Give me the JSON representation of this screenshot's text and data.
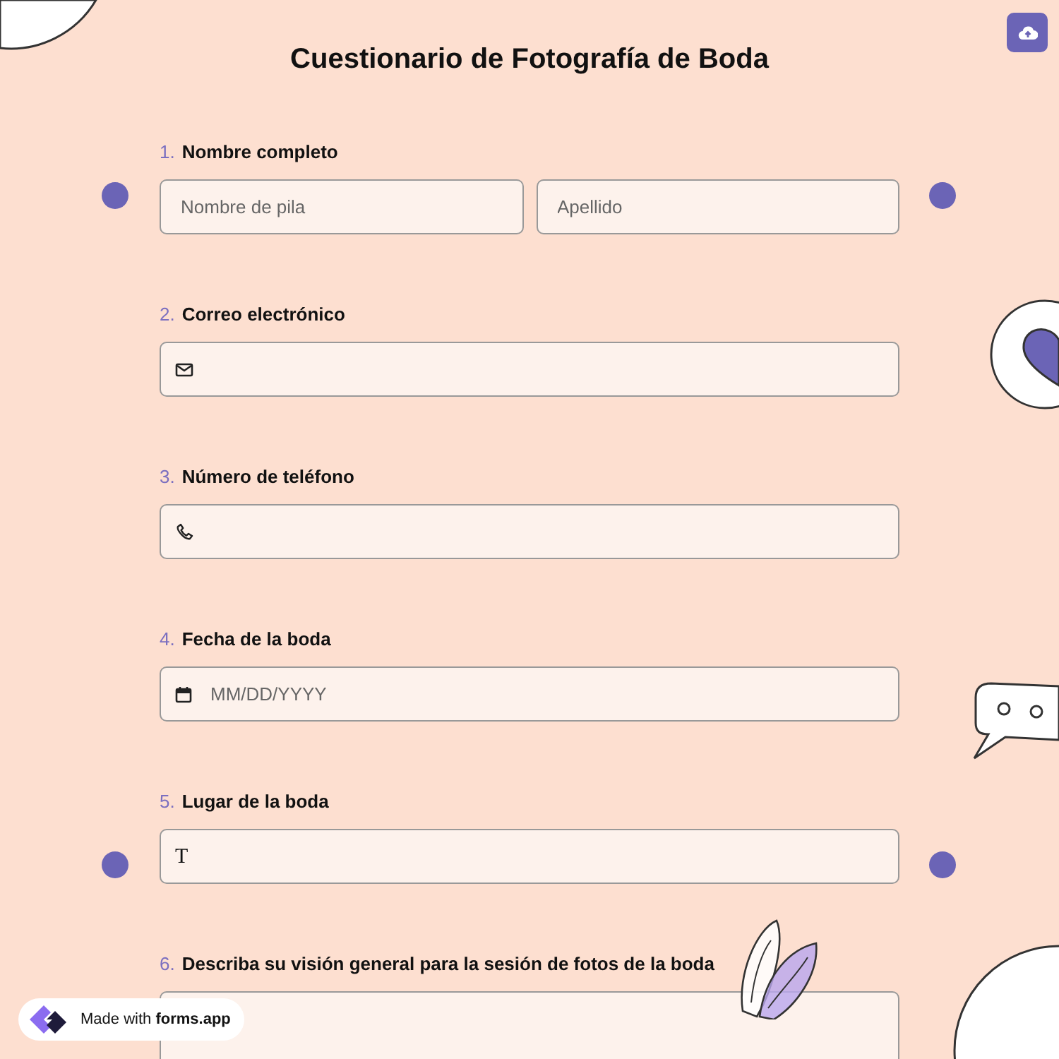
{
  "title": "Cuestionario de Fotografía de Boda",
  "questions": [
    {
      "number": "1.",
      "label": "Nombre completo",
      "kind": "name",
      "fields": [
        {
          "placeholder": "Nombre de pila"
        },
        {
          "placeholder": "Apellido"
        }
      ]
    },
    {
      "number": "2.",
      "label": "Correo electrónico",
      "kind": "email"
    },
    {
      "number": "3.",
      "label": "Número de teléfono",
      "kind": "phone"
    },
    {
      "number": "4.",
      "label": "Fecha de la boda",
      "kind": "date",
      "placeholder": "MM/DD/YYYY"
    },
    {
      "number": "5.",
      "label": "Lugar de la boda",
      "kind": "text",
      "icon_text": "T"
    },
    {
      "number": "6.",
      "label": "Describa su visión general para la sesión de fotos de la boda",
      "kind": "textarea"
    }
  ],
  "badge": {
    "text": "Made with **forms.app**"
  }
}
